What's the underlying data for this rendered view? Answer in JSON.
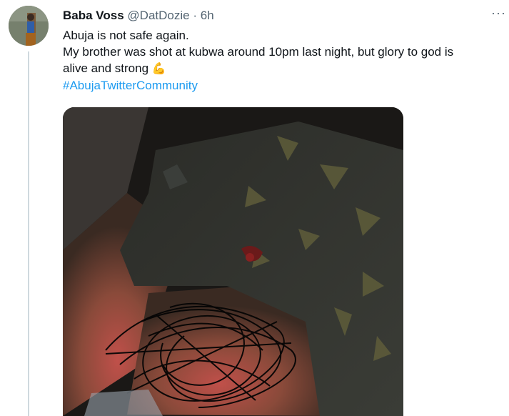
{
  "tweet": {
    "author_name": "Baba Voss",
    "handle": "@DatDozie",
    "separator": "·",
    "time": "6h",
    "more_label": "···",
    "lines": [
      "Abuja is not safe again.",
      "My brother was shot at kubwa around 10pm last night, but glory to god is",
      "alive and strong"
    ],
    "emoji": "💪",
    "hashtag": "#AbujaTwitterCommunity"
  },
  "colors": {
    "link": "#1d9bf0",
    "muted": "#536471",
    "text": "#0f1419"
  },
  "icons": {
    "more": "more-horizontal-icon"
  }
}
